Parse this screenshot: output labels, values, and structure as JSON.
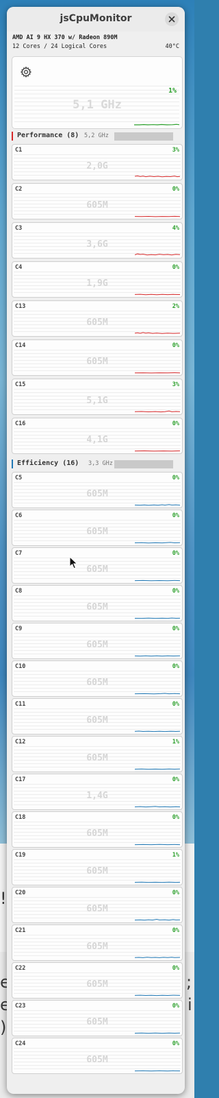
{
  "window": {
    "title": "jsCpuMonitor",
    "cpu_model": "AMD AI 9 HX 370 w/ Radeon 890M",
    "cores_info": "12 Cores / 24 Logical Cores",
    "temperature": "40°C"
  },
  "total": {
    "usage": "1%",
    "frequency": "5,1 GHz",
    "usage_fraction": 0.01
  },
  "colors": {
    "performance": "#d62728",
    "efficiency": "#1f77b4",
    "usage_text": "#2ca02c",
    "total_line": "#2ca02c"
  },
  "groups": {
    "performance": {
      "label": "Performance (8)",
      "frequency": "5,2 GHz",
      "cores": [
        {
          "name": "C1",
          "usage": "3%",
          "frequency": "2,0G"
        },
        {
          "name": "C2",
          "usage": "0%",
          "frequency": "605M"
        },
        {
          "name": "C3",
          "usage": "4%",
          "frequency": "3,6G"
        },
        {
          "name": "C4",
          "usage": "0%",
          "frequency": "1,9G"
        },
        {
          "name": "C13",
          "usage": "2%",
          "frequency": "605M"
        },
        {
          "name": "C14",
          "usage": "0%",
          "frequency": "605M"
        },
        {
          "name": "C15",
          "usage": "3%",
          "frequency": "5,1G"
        },
        {
          "name": "C16",
          "usage": "0%",
          "frequency": "4,1G"
        }
      ]
    },
    "efficiency": {
      "label": "Efficiency (16)",
      "frequency": "3,3 GHz",
      "cores": [
        {
          "name": "C5",
          "usage": "0%",
          "frequency": "605M"
        },
        {
          "name": "C6",
          "usage": "0%",
          "frequency": "605M"
        },
        {
          "name": "C7",
          "usage": "0%",
          "frequency": "605M"
        },
        {
          "name": "C8",
          "usage": "0%",
          "frequency": "605M"
        },
        {
          "name": "C9",
          "usage": "0%",
          "frequency": "605M"
        },
        {
          "name": "C10",
          "usage": "0%",
          "frequency": "605M"
        },
        {
          "name": "C11",
          "usage": "0%",
          "frequency": "605M"
        },
        {
          "name": "C12",
          "usage": "1%",
          "frequency": "605M"
        },
        {
          "name": "C17",
          "usage": "0%",
          "frequency": "1,4G"
        },
        {
          "name": "C18",
          "usage": "0%",
          "frequency": "605M"
        },
        {
          "name": "C19",
          "usage": "1%",
          "frequency": "605M"
        },
        {
          "name": "C20",
          "usage": "0%",
          "frequency": "605M"
        },
        {
          "name": "C21",
          "usage": "0%",
          "frequency": "605M"
        },
        {
          "name": "C22",
          "usage": "0%",
          "frequency": "605M"
        },
        {
          "name": "C23",
          "usage": "0%",
          "frequency": "605M"
        },
        {
          "name": "C24",
          "usage": "0%",
          "frequency": "605M"
        }
      ]
    }
  },
  "background": {
    "fragments": [
      "!",
      "e",
      "e",
      ")",
      ";",
      "i"
    ]
  },
  "icons": {
    "close": "close-icon",
    "settings": "gear-icon",
    "cursor": "mouse-pointer-icon"
  }
}
